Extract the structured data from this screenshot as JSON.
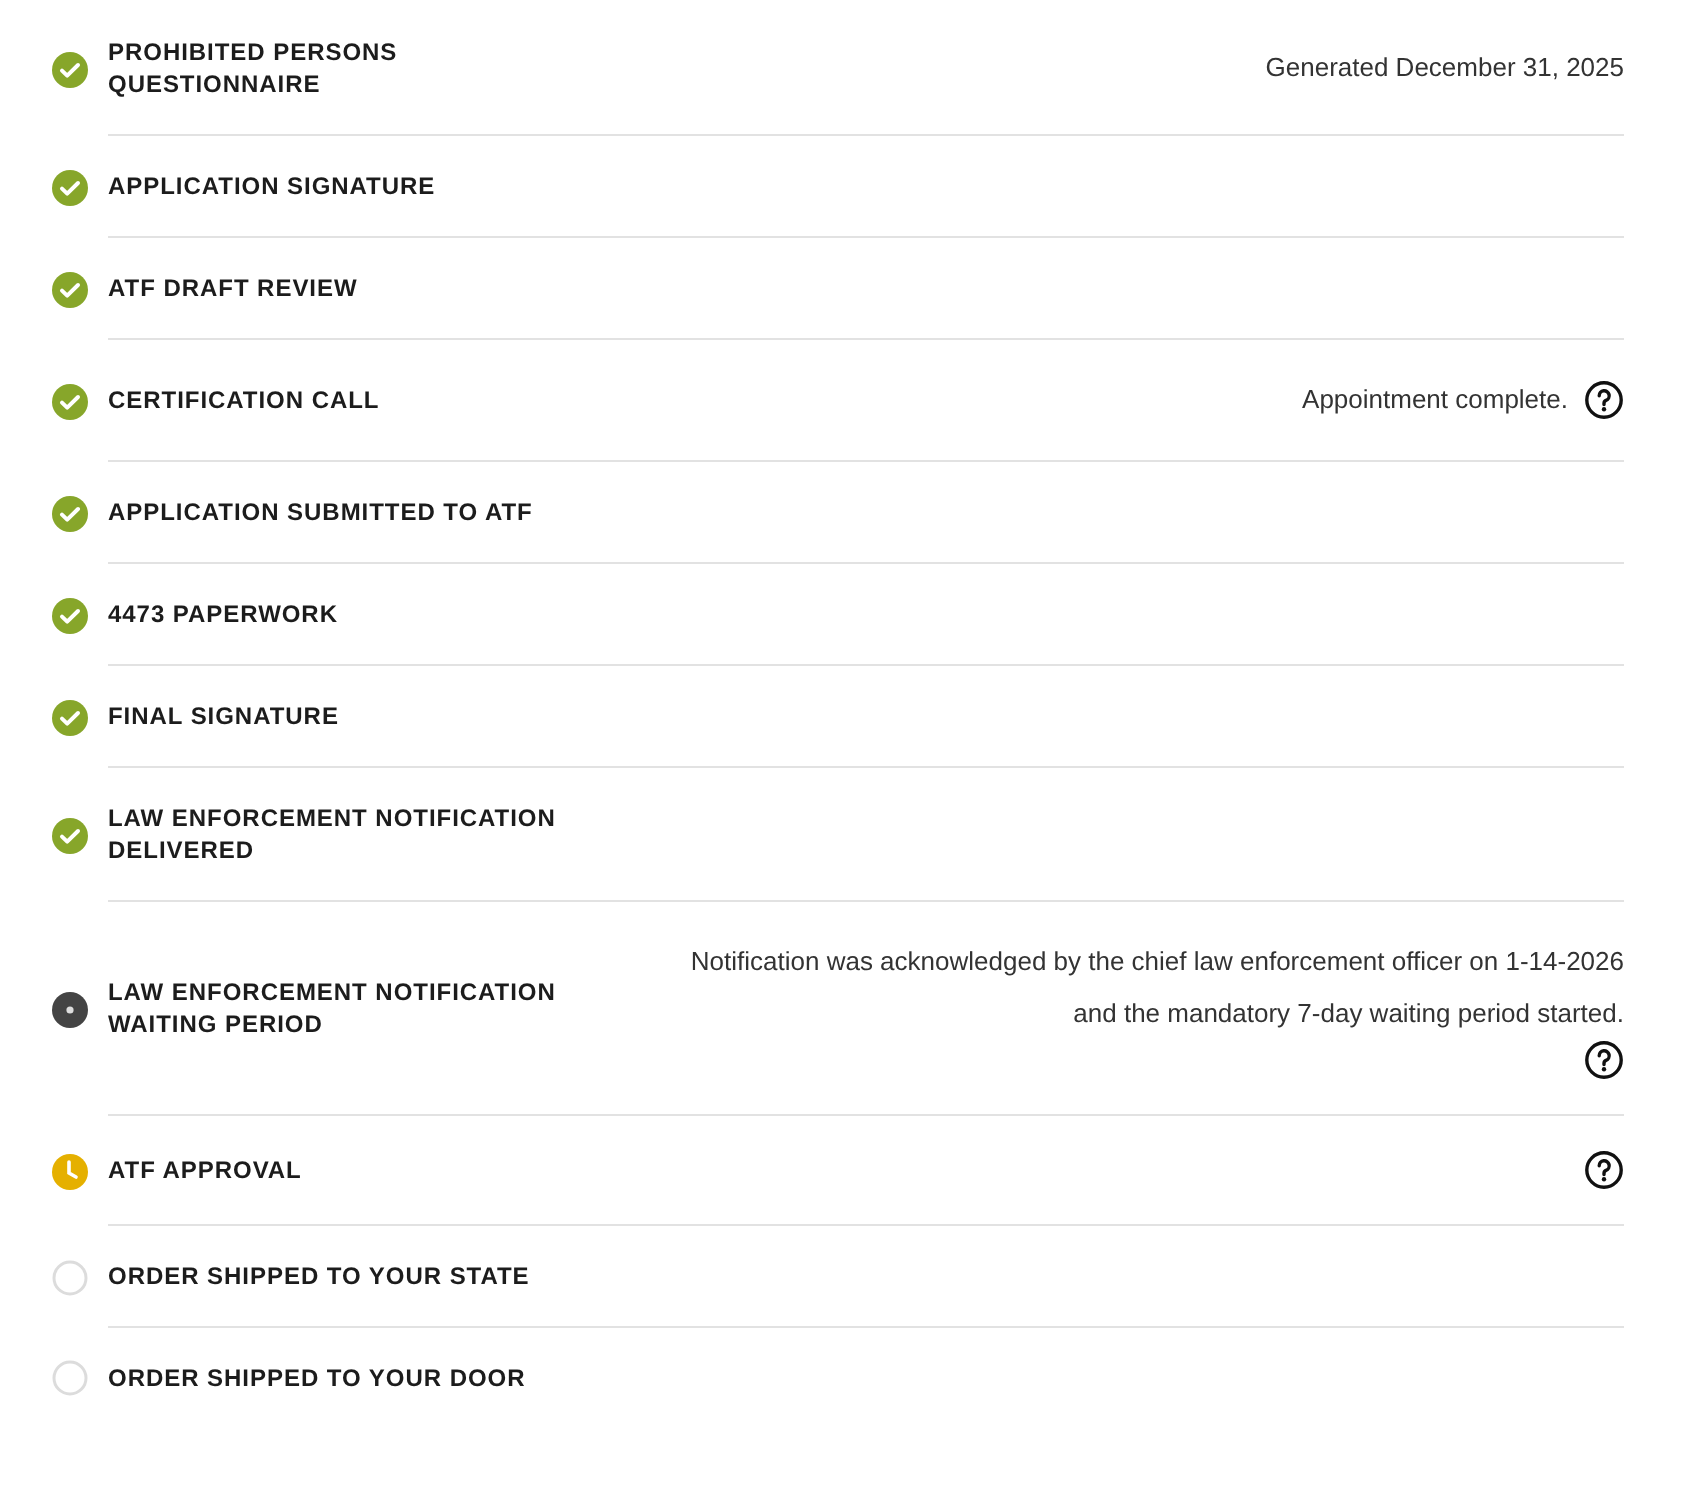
{
  "steps": [
    {
      "title": "PROHIBITED PERSONS QUESTIONNAIRE",
      "kind": "complete",
      "note": "Generated December 31, 2025",
      "help": false
    },
    {
      "title": "APPLICATION SIGNATURE",
      "kind": "complete",
      "help": false
    },
    {
      "title": "ATF DRAFT REVIEW",
      "kind": "complete",
      "help": false
    },
    {
      "title": "CERTIFICATION CALL",
      "kind": "complete",
      "note": "Appointment complete.",
      "help": true
    },
    {
      "title": "APPLICATION SUBMITTED TO ATF",
      "kind": "complete",
      "help": false
    },
    {
      "title": "4473 PAPERWORK",
      "kind": "complete",
      "help": false
    },
    {
      "title": "FINAL SIGNATURE",
      "kind": "complete",
      "help": false
    },
    {
      "title": "LAW ENFORCEMENT NOTIFICATION DELIVERED",
      "kind": "complete",
      "help": false
    },
    {
      "title": "LAW ENFORCEMENT NOTIFICATION WAITING PERIOD",
      "kind": "current",
      "note": "Notification was acknowledged by the chief law enforcement officer on 1-14-2026 and the mandatory 7-day waiting period started.",
      "help": true
    },
    {
      "title": "ATF APPROVAL",
      "kind": "pending",
      "help": true
    },
    {
      "title": "ORDER SHIPPED TO YOUR STATE",
      "kind": "not_started",
      "help": false
    },
    {
      "title": "ORDER SHIPPED TO YOUR DOOR",
      "kind": "not_started",
      "help": false
    }
  ]
}
